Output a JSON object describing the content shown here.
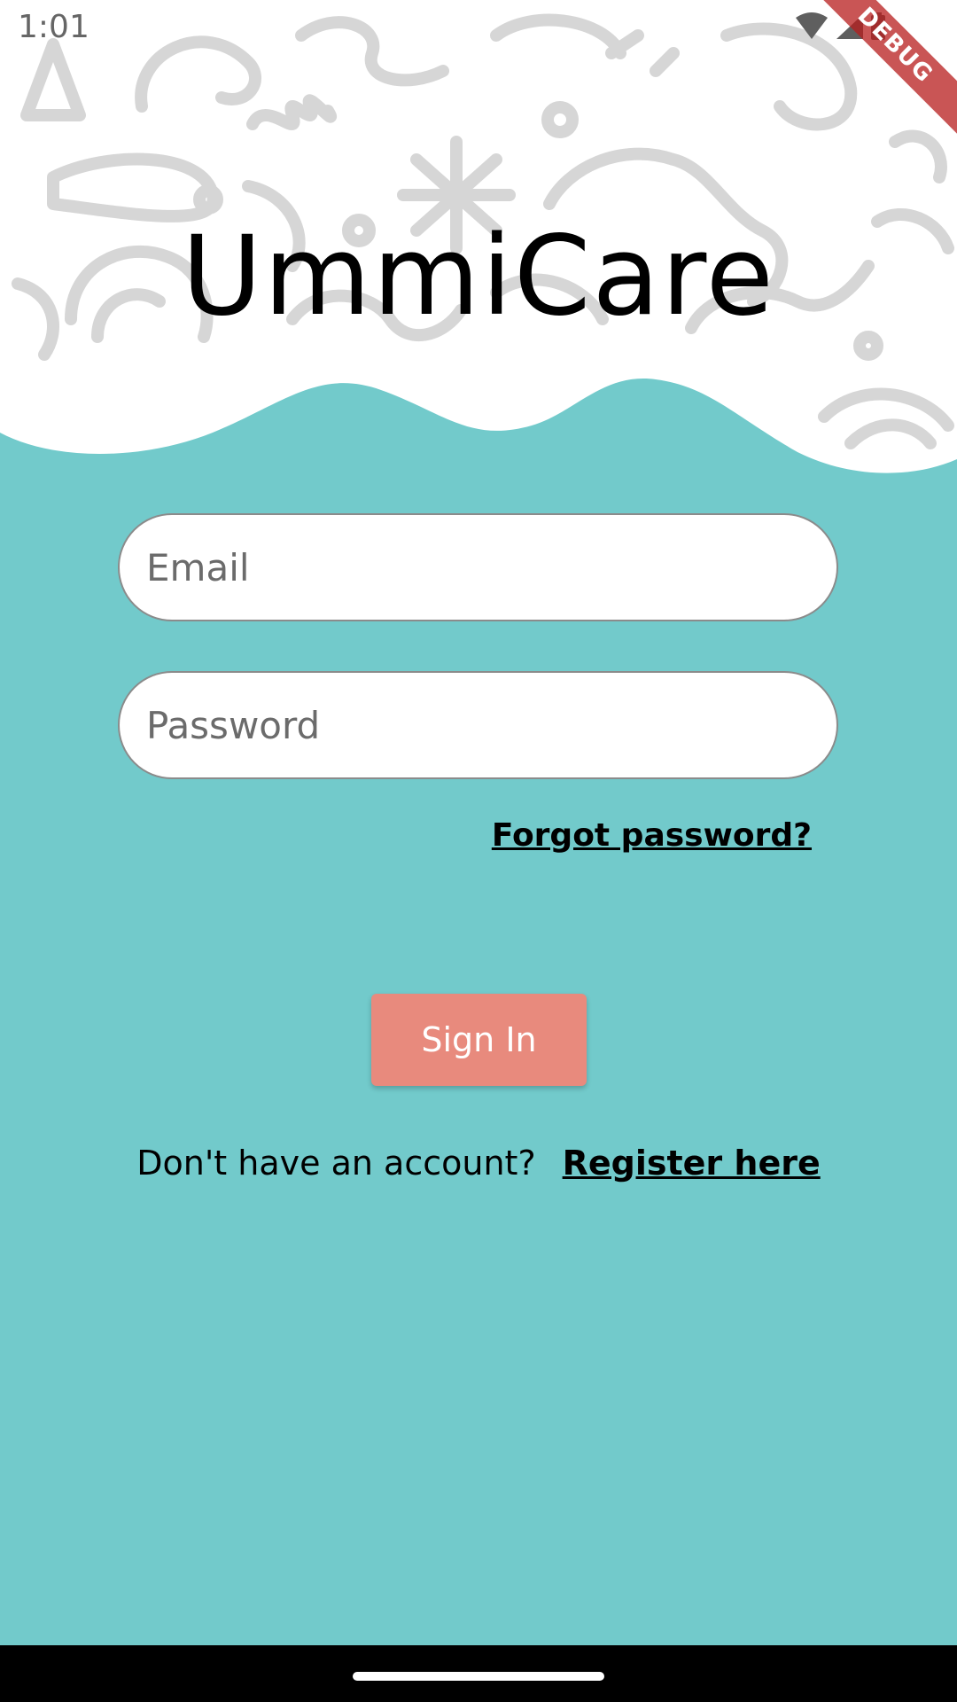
{
  "status_bar": {
    "time": "1:01"
  },
  "debug_banner": "DEBUG",
  "app": {
    "title": "UmmiCare"
  },
  "form": {
    "email_placeholder": "Email",
    "email_value": "",
    "password_placeholder": "Password",
    "password_value": "",
    "forgot_password_label": "Forgot password?",
    "sign_in_label": "Sign In"
  },
  "register": {
    "prompt": "Don't have an account?",
    "link_label": "Register here"
  },
  "colors": {
    "background": "#72cacb",
    "header_background": "#ffffff",
    "doodle": "#d6d6d6",
    "primary_button": "#e88a7d",
    "text": "#000000"
  },
  "icons": [
    "wifi-icon",
    "signal-icon",
    "battery-icon"
  ]
}
